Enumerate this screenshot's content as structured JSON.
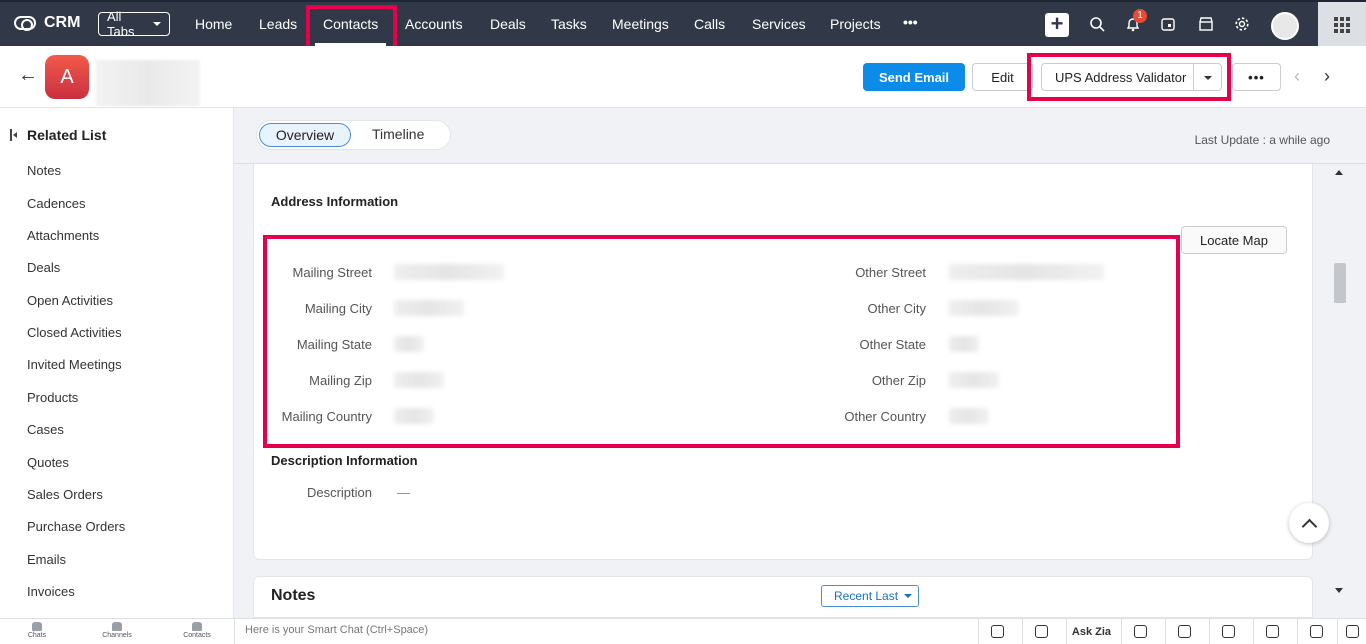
{
  "app": {
    "name": "CRM"
  },
  "topnav": {
    "all_tabs": "All Tabs",
    "tabs": [
      {
        "label": "Home"
      },
      {
        "label": "Leads"
      },
      {
        "label": "Contacts"
      },
      {
        "label": "Accounts"
      },
      {
        "label": "Deals"
      },
      {
        "label": "Tasks"
      },
      {
        "label": "Meetings"
      },
      {
        "label": "Calls"
      },
      {
        "label": "Services"
      },
      {
        "label": "Projects"
      }
    ],
    "active_tab": "Contacts",
    "more": "•••",
    "notification_count": "1"
  },
  "record": {
    "avatar_letter": "A",
    "buttons": {
      "send_email": "Send Email",
      "edit": "Edit",
      "ups": "UPS Address Validator",
      "more": "•••"
    }
  },
  "sidebar": {
    "title": "Related List",
    "items": [
      "Notes",
      "Cadences",
      "Attachments",
      "Deals",
      "Open Activities",
      "Closed Activities",
      "Invited Meetings",
      "Products",
      "Cases",
      "Quotes",
      "Sales Orders",
      "Purchase Orders",
      "Emails",
      "Invoices"
    ]
  },
  "tabs": {
    "overview": "Overview",
    "timeline": "Timeline",
    "last_update": "Last Update : a while ago"
  },
  "address": {
    "title": "Address Information",
    "locate_map": "Locate Map",
    "mailing": [
      "Mailing Street",
      "Mailing City",
      "Mailing State",
      "Mailing Zip",
      "Mailing Country"
    ],
    "other": [
      "Other Street",
      "Other City",
      "Other State",
      "Other Zip",
      "Other Country"
    ]
  },
  "description": {
    "title": "Description Information",
    "label": "Description",
    "value": "—"
  },
  "notes": {
    "title": "Notes",
    "sort": "Recent Last"
  },
  "bottombar": {
    "tabs": [
      "Chats",
      "Channels",
      "Contacts"
    ],
    "smart_chat_placeholder": "Here is your Smart Chat (Ctrl+Space)",
    "ask_zia": "Ask Zia"
  },
  "colors": {
    "nav_bg": "#313949",
    "primary": "#0d8be8",
    "highlight": "#e6004c"
  }
}
